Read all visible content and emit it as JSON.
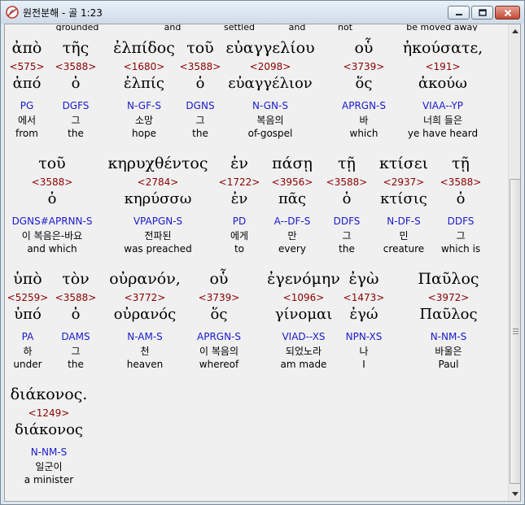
{
  "window": {
    "title": "원전분해 - 골 1:23"
  },
  "top_glosses": [
    "grounded",
    "and",
    "settled",
    "and",
    "not",
    "be moved away"
  ],
  "rows": [
    [
      {
        "greek": "ἀπὸ",
        "strong": "<575>",
        "lemma": "ἀπό",
        "morph": "PG",
        "korean": "에서",
        "english": "from"
      },
      {
        "greek": "τῆς",
        "strong": "<3588>",
        "lemma": "ὁ",
        "morph": "DGFS",
        "korean": "그",
        "english": "the"
      },
      {
        "greek": "ἐλπίδος",
        "strong": "<1680>",
        "lemma": "ἐλπίς",
        "morph": "N-GF-S",
        "korean": "소망",
        "english": "hope"
      },
      {
        "greek": "τοῦ",
        "strong": "<3588>",
        "lemma": "ὁ",
        "morph": "DGNS",
        "korean": "그",
        "english": "the"
      },
      {
        "greek": "εὐαγγελίου",
        "strong": "<2098>",
        "lemma": "εὐαγγέλιον",
        "morph": "N-GN-S",
        "korean": "복음의",
        "english": "of-gospel"
      },
      {
        "greek": "οὗ",
        "strong": "<3739>",
        "lemma": "ὅς",
        "morph": "APRGN-S",
        "korean": "바",
        "english": "which"
      },
      {
        "greek": "ἠκούσατε,",
        "strong": "<191>",
        "lemma": "ἀκούω",
        "morph": "VIAA--YP",
        "korean": "너희 들은",
        "english": "ye have heard"
      }
    ],
    [
      {
        "greek": "τοῦ",
        "strong": "<3588>",
        "lemma": "ὁ",
        "morph": "DGNS#APRNN-S",
        "korean": "이 복음은-바요",
        "english": "and which"
      },
      {
        "greek": "κηρυχθέντος",
        "strong": "<2784>",
        "lemma": "κηρύσσω",
        "morph": "VPAPGN-S",
        "korean": "전파된",
        "english": "was preached"
      },
      {
        "greek": "ἐν",
        "strong": "<1722>",
        "lemma": "ἐν",
        "morph": "PD",
        "korean": "에게",
        "english": "to"
      },
      {
        "greek": "πάσῃ",
        "strong": "<3956>",
        "lemma": "πᾶς",
        "morph": "A--DF-S",
        "korean": "만",
        "english": "every"
      },
      {
        "greek": "τῇ",
        "strong": "<3588>",
        "lemma": "ὁ",
        "morph": "DDFS",
        "korean": "그",
        "english": "the"
      },
      {
        "greek": "κτίσει",
        "strong": "<2937>",
        "lemma": "κτίσις",
        "morph": "N-DF-S",
        "korean": "민",
        "english": "creature"
      },
      {
        "greek": "τῇ",
        "strong": "<3588>",
        "lemma": "ὁ",
        "morph": "DDFS",
        "korean": "그",
        "english": "which is"
      }
    ],
    [
      {
        "greek": "ὑπὸ",
        "strong": "<5259>",
        "lemma": "ὑπό",
        "morph": "PA",
        "korean": "하",
        "english": "under"
      },
      {
        "greek": "τὸν",
        "strong": "<3588>",
        "lemma": "ὁ",
        "morph": "DAMS",
        "korean": "그",
        "english": "the"
      },
      {
        "greek": "οὐρανόν,",
        "strong": "<3772>",
        "lemma": "οὐρανός",
        "morph": "N-AM-S",
        "korean": "천",
        "english": "heaven"
      },
      {
        "greek": "οὗ",
        "strong": "<3739>",
        "lemma": "ὅς",
        "morph": "APRGN-S",
        "korean": "이 복음의",
        "english": "whereof"
      },
      {
        "greek": "ἐγενόμην",
        "strong": "<1096>",
        "lemma": "γίνομαι",
        "morph": "VIAD--XS",
        "korean": "되었노라",
        "english": "am made"
      },
      {
        "greek": "ἐγὼ",
        "strong": "<1473>",
        "lemma": "ἐγώ",
        "morph": "NPN-XS",
        "korean": "나",
        "english": "I"
      },
      {
        "greek": "Παῦλος",
        "strong": "<3972>",
        "lemma": "Παῦλος",
        "morph": "N-NM-S",
        "korean": "바울은",
        "english": "Paul"
      }
    ],
    [
      {
        "greek": "διάκονος.",
        "strong": "<1249>",
        "lemma": "διάκονος",
        "morph": "N-NM-S",
        "korean": "일군이",
        "english": "a minister"
      }
    ]
  ]
}
